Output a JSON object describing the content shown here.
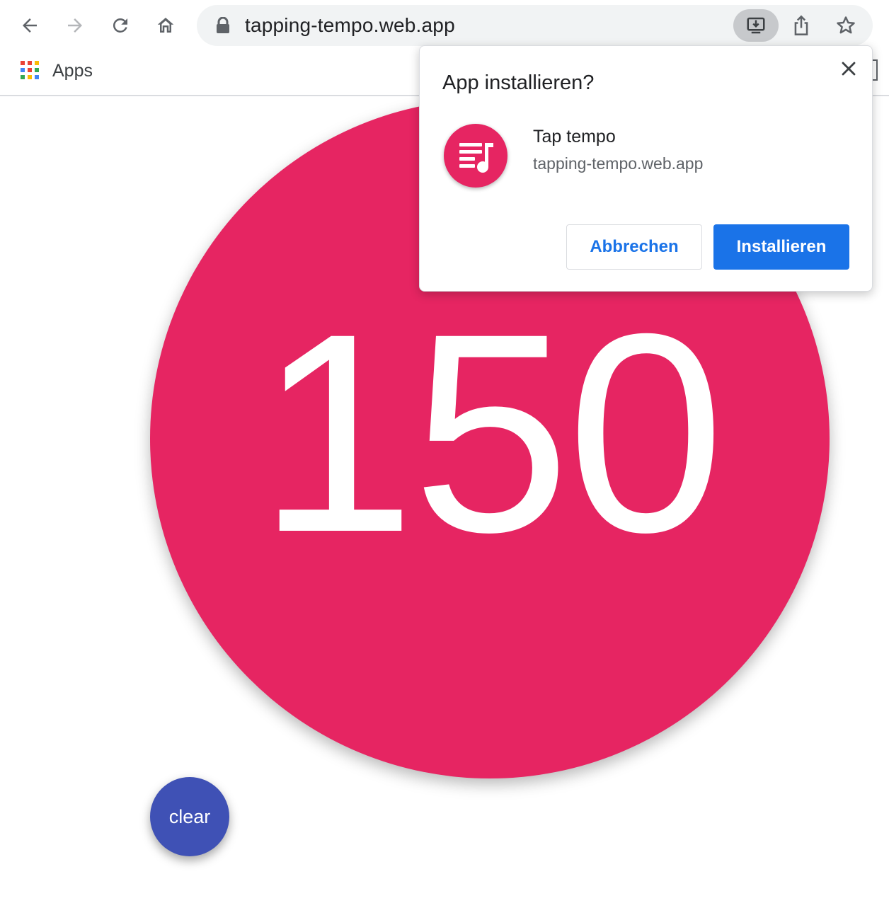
{
  "browser": {
    "url": "tapping-tempo.web.app",
    "bookmarks_bar": {
      "apps_label": "Apps"
    },
    "icons": [
      "back-icon",
      "forward-icon",
      "reload-icon",
      "home-icon",
      "lock-icon",
      "install-app-icon",
      "share-icon",
      "bookmark-star-icon",
      "apps-grid-icon"
    ]
  },
  "page": {
    "bpm": "150",
    "clear_label": "clear",
    "colors": {
      "tap_circle": "#e62562",
      "clear_button": "#3f51b5",
      "text": "#ffffff"
    }
  },
  "install_dialog": {
    "title": "App installieren?",
    "app_name": "Tap tempo",
    "app_origin": "tapping-tempo.web.app",
    "cancel_label": "Abbrechen",
    "install_label": "Installieren",
    "colors": {
      "primary": "#1a73e8",
      "icon_bg": "#e62562"
    }
  }
}
